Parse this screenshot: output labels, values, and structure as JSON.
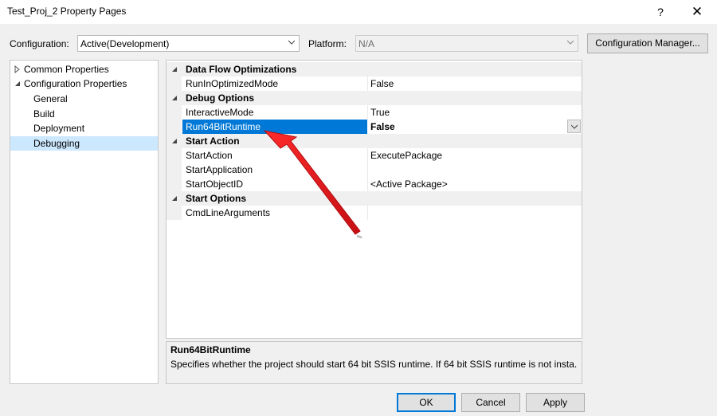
{
  "window": {
    "title": "Test_Proj_2 Property Pages",
    "help_glyph": "?",
    "close_glyph": "✕"
  },
  "toolbar": {
    "configuration_label": "Configuration:",
    "configuration_value": "Active(Development)",
    "platform_label": "Platform:",
    "platform_value": "N/A",
    "config_manager_label": "Configuration Manager..."
  },
  "tree": {
    "items": [
      {
        "label": "Common Properties",
        "expanded": false
      },
      {
        "label": "Configuration Properties",
        "expanded": true
      },
      {
        "label": "General"
      },
      {
        "label": "Build"
      },
      {
        "label": "Deployment"
      },
      {
        "label": "Debugging",
        "selected": true
      }
    ]
  },
  "grid": {
    "categories": [
      {
        "name": "Data Flow Optimizations",
        "properties": [
          {
            "name": "RunInOptimizedMode",
            "value": "False"
          }
        ]
      },
      {
        "name": "Debug Options",
        "properties": [
          {
            "name": "InteractiveMode",
            "value": "True"
          },
          {
            "name": "Run64BitRuntime",
            "value": "False",
            "selected": true
          }
        ]
      },
      {
        "name": "Start Action",
        "properties": [
          {
            "name": "StartAction",
            "value": "ExecutePackage"
          },
          {
            "name": "StartApplication",
            "value": ""
          },
          {
            "name": "StartObjectID",
            "value": "<Active Package>"
          }
        ]
      },
      {
        "name": "Start Options",
        "properties": [
          {
            "name": "CmdLineArguments",
            "value": ""
          }
        ]
      }
    ]
  },
  "description": {
    "title": "Run64BitRuntime",
    "text": "Specifies whether the project should start 64 bit SSIS runtime. If 64 bit SSIS runtime is not insta..."
  },
  "buttons": {
    "ok": "OK",
    "cancel": "Cancel",
    "apply": "Apply"
  },
  "colors": {
    "selection": "#0078d7",
    "annotation_arrow": "#e3161b"
  }
}
